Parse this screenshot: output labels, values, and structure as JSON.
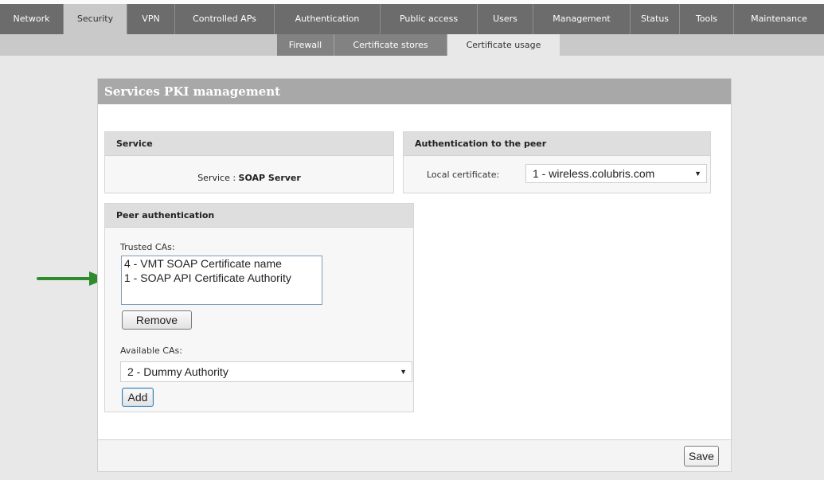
{
  "main_tabs": [
    {
      "label": "Network",
      "active": false
    },
    {
      "label": "Security",
      "active": true
    },
    {
      "label": "VPN",
      "active": false
    },
    {
      "label": "Controlled APs",
      "active": false
    },
    {
      "label": "Authentication",
      "active": false
    },
    {
      "label": "Public access",
      "active": false
    },
    {
      "label": "Users",
      "active": false
    },
    {
      "label": "Management",
      "active": false
    },
    {
      "label": "Status",
      "active": false
    },
    {
      "label": "Tools",
      "active": false
    },
    {
      "label": "Maintenance",
      "active": false
    }
  ],
  "sub_tabs": [
    {
      "label": "Firewall",
      "active": false
    },
    {
      "label": "Certificate stores",
      "active": false
    },
    {
      "label": "Certificate usage",
      "active": true
    }
  ],
  "panel": {
    "title": "Services PKI management",
    "save_label": "Save"
  },
  "service": {
    "header": "Service",
    "prefix": "Service : ",
    "value": "SOAP Server"
  },
  "peer_auth": {
    "header": "Authentication to the peer",
    "local_cert_label": "Local certificate:",
    "local_cert_value": "1 - wireless.colubris.com"
  },
  "peer_authentication": {
    "header": "Peer authentication",
    "trusted_label": "Trusted CAs:",
    "trusted_items": [
      "4 - VMT SOAP Certificate name",
      "1 - SOAP API Certificate Authority"
    ],
    "remove_label": "Remove",
    "available_label": "Available CAs:",
    "available_value": "2 - Dummy Authority",
    "add_label": "Add"
  },
  "colors": {
    "tab_bar": "#6c6c6c",
    "active_tab": "#c9c9c9",
    "panel_title": "#a8a8a8",
    "arrow": "#2e8b2e"
  }
}
